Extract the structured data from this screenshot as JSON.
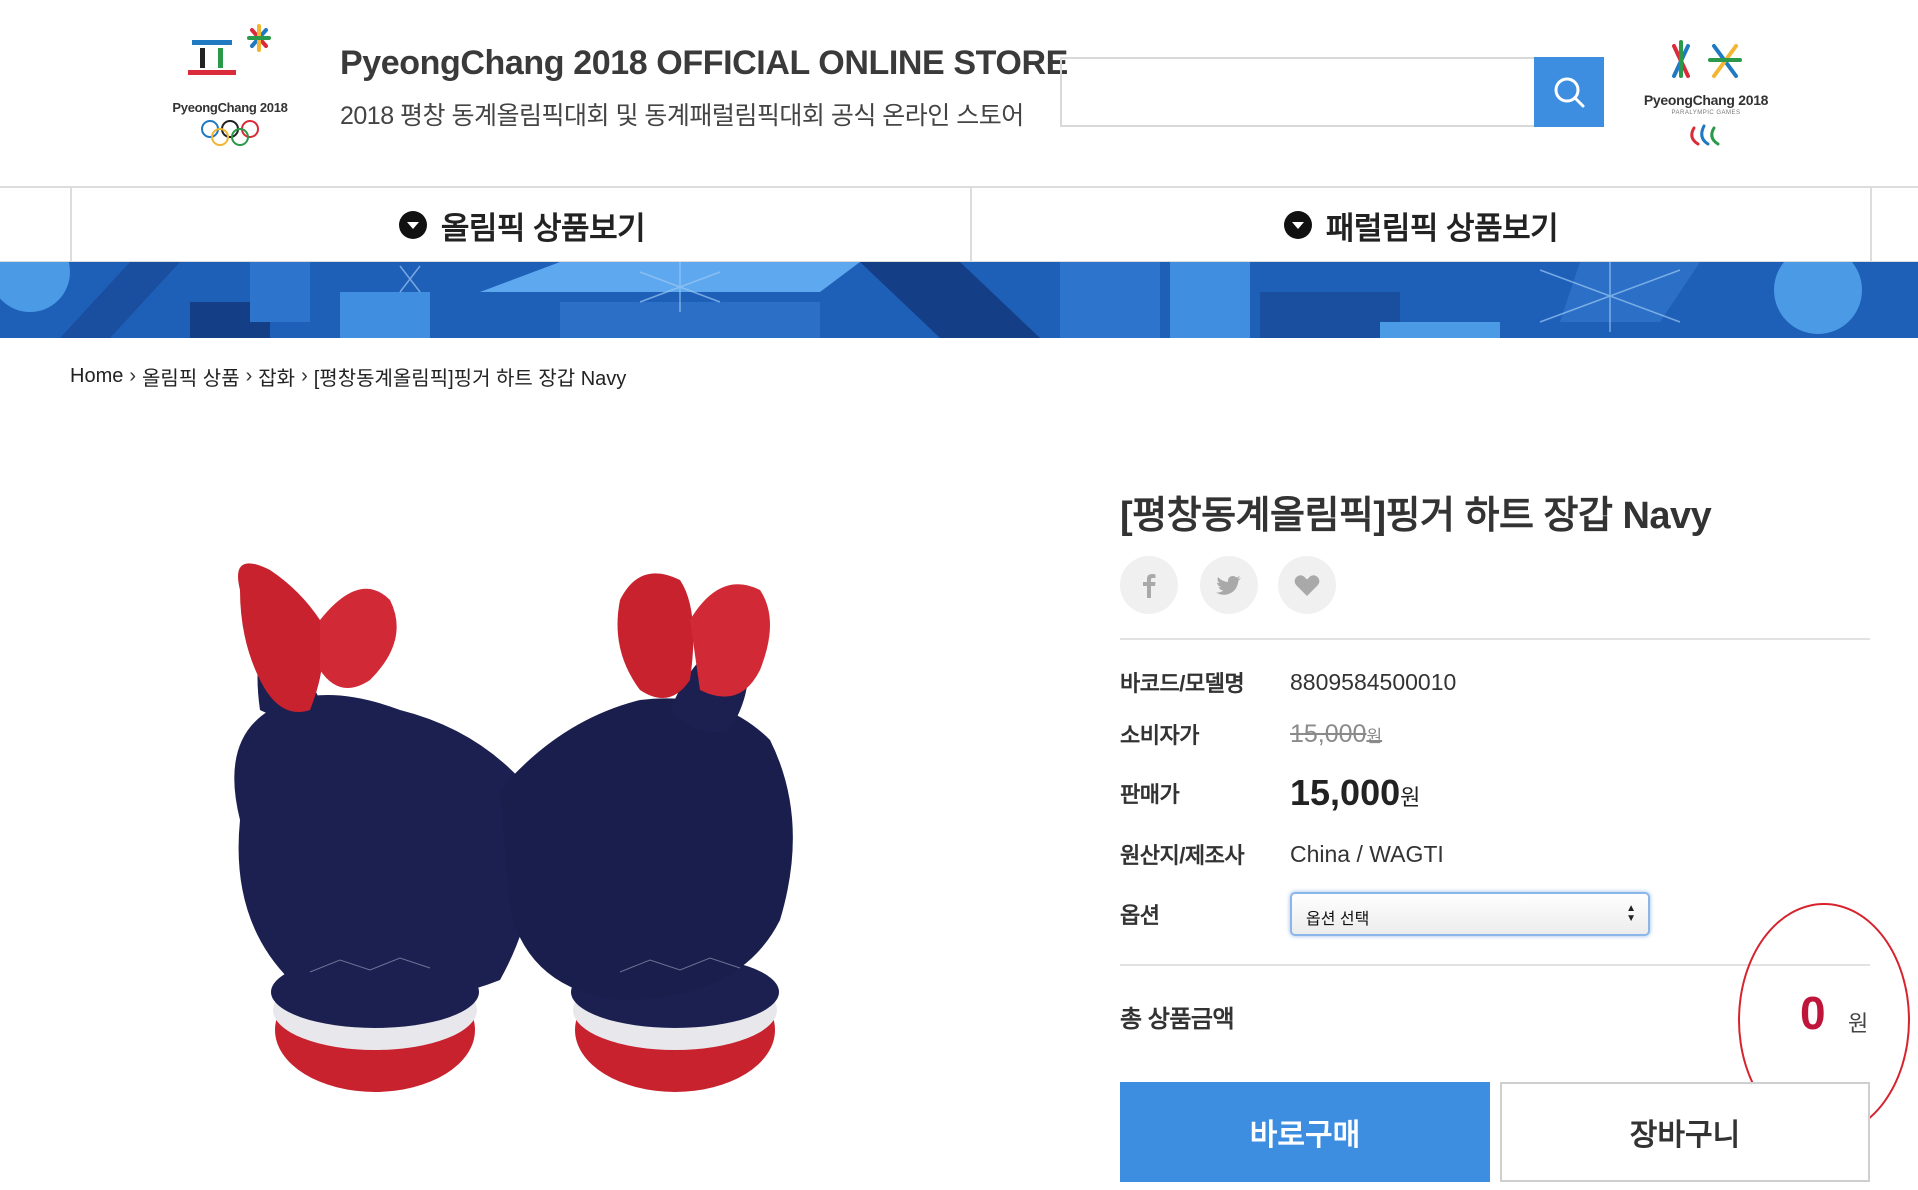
{
  "header": {
    "olympic_logo_text": "PyeongChang 2018",
    "store_title": "PyeongChang 2018 OFFICIAL ONLINE STORE",
    "store_subtitle": "2018 평창 동계올림픽대회 및 동계패럴림픽대회 공식 온라인 스토어",
    "search": {
      "value": "",
      "placeholder": ""
    },
    "paralympic_logo_text": "PyeongChang 2018",
    "paralympic_logo_small": "PARALYMPIC GAMES"
  },
  "nav": {
    "tabs": [
      {
        "label": "올림픽 상품보기"
      },
      {
        "label": "패럴림픽 상품보기"
      }
    ]
  },
  "breadcrumb": [
    "Home",
    "올림픽 상품",
    "잡화",
    "[평창동계올림픽]핑거 하트 장갑 Navy"
  ],
  "product": {
    "title": "[평창동계올림픽]핑거 하트 장갑 Navy",
    "barcode_label": "바코드/모델명",
    "barcode_value": "8809584500010",
    "consumer_price_label": "소비자가",
    "consumer_price": "15,000",
    "consumer_price_unit": "원",
    "sale_price_label": "판매가",
    "sale_price": "15,000",
    "sale_price_unit": "원",
    "origin_label": "원산지/제조사",
    "origin_value": "China / WAGTI",
    "option_label": "옵션",
    "option_selected": "옵션 선택",
    "total_label": "총 상품금액",
    "total_value": "0",
    "total_unit": "원",
    "buy_now_label": "바로구매",
    "cart_label": "장바구니"
  },
  "colors": {
    "accent_blue": "#3d8ee0",
    "banner_blue": "#1e5fb8",
    "total_red": "#c0153a",
    "annotation_red": "#d6232e"
  },
  "icons": [
    "search-icon",
    "facebook-icon",
    "twitter-icon",
    "heart-icon",
    "chevron-down-icon"
  ]
}
